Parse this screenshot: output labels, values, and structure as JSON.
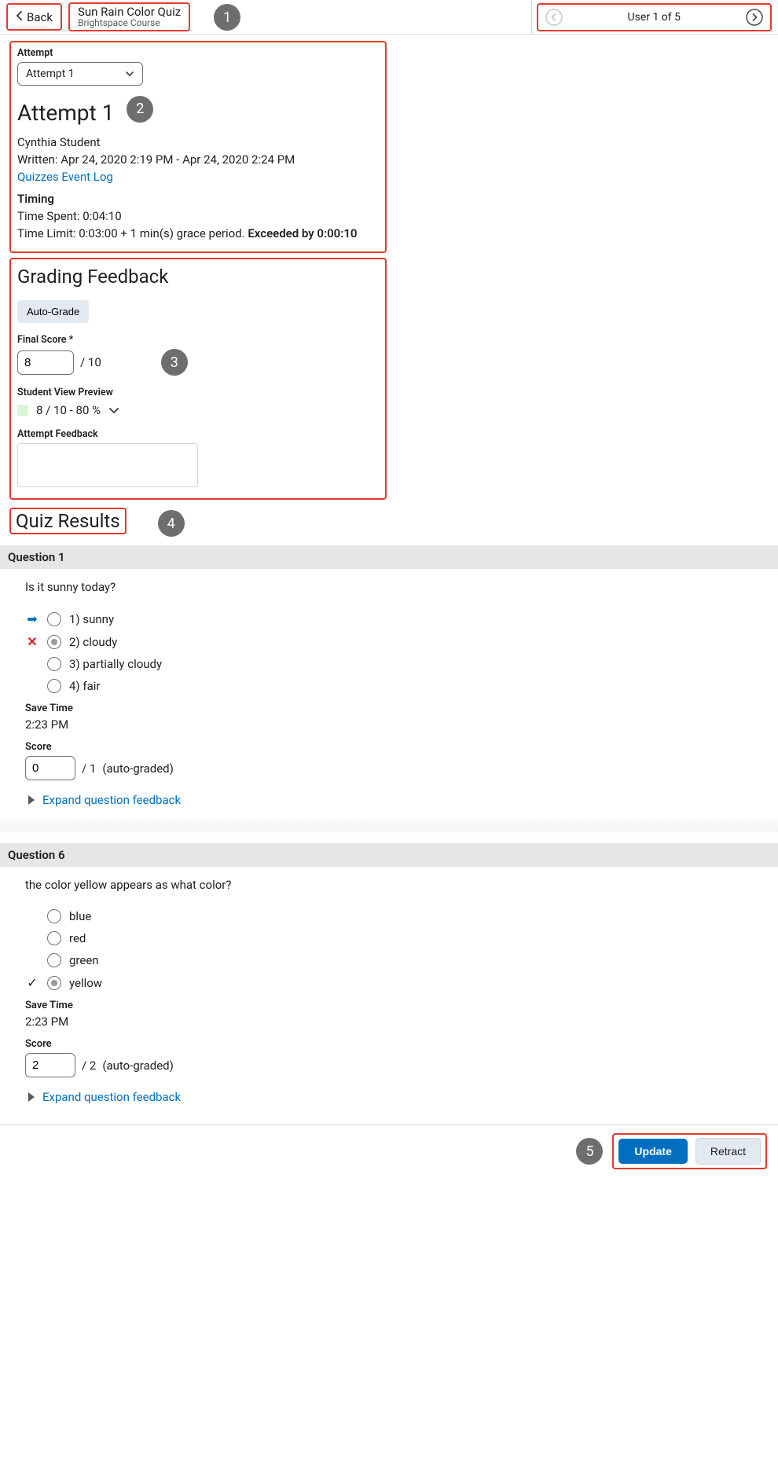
{
  "header": {
    "back": "Back",
    "title": "Sun Rain Color Quiz",
    "subtitle": "Brightspace Course",
    "pager_label": "User 1 of 5"
  },
  "callouts": {
    "c1": "1",
    "c2": "2",
    "c3": "3",
    "c4": "4",
    "c5": "5"
  },
  "attempt": {
    "label": "Attempt",
    "selected": "Attempt 1",
    "heading": "Attempt 1",
    "student": "Cynthia Student",
    "written": "Written: Apr 24, 2020 2:19 PM - Apr 24, 2020 2:24 PM",
    "event_log": "Quizzes Event Log",
    "timing_label": "Timing",
    "time_spent": "Time Spent: 0:04:10",
    "time_limit_prefix": "Time Limit: 0:03:00 + 1 min(s) grace period. ",
    "time_limit_exceeded": "Exceeded by 0:00:10"
  },
  "grading": {
    "heading": "Grading Feedback",
    "auto_grade": "Auto-Grade",
    "final_score_label": "Final Score *",
    "final_score_value": "8",
    "final_score_denom": "/ 10",
    "preview_label": "Student View Preview",
    "preview_text": "8 / 10 - 80 %",
    "feedback_label": "Attempt Feedback"
  },
  "results": {
    "heading": "Quiz Results",
    "expand_label": "Expand question feedback",
    "save_time_label": "Save Time",
    "score_label": "Score",
    "auto_graded_suffix": "  (auto-graded)",
    "q1": {
      "title": "Question 1",
      "prompt": "Is it sunny today?",
      "opts": [
        "1)  sunny",
        "2)  cloudy",
        "3)  partially cloudy",
        "4)  fair"
      ],
      "save_time": "2:23 PM",
      "score_value": "0",
      "score_denom": "/ 1"
    },
    "q6": {
      "title": "Question 6",
      "prompt": "the color yellow appears as what color?",
      "opts": [
        "blue",
        "red",
        "green",
        "yellow"
      ],
      "save_time": "2:23 PM",
      "score_value": "2",
      "score_denom": "/ 2"
    }
  },
  "footer": {
    "update": "Update",
    "retract": "Retract"
  }
}
